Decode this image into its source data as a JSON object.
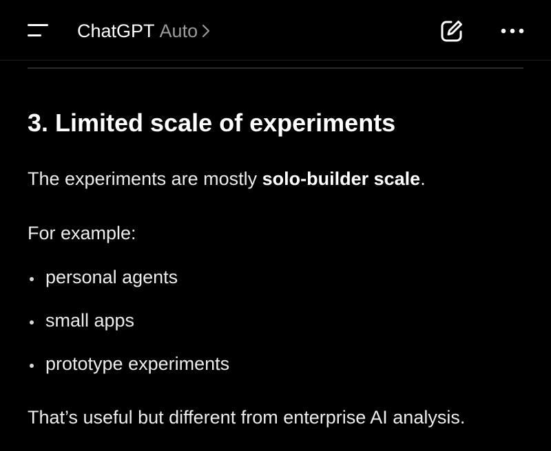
{
  "header": {
    "menu_icon": "hamburger-menu-icon",
    "title": "ChatGPT",
    "model": "Auto",
    "chevron_icon": "chevron-right-icon",
    "compose_icon": "new-chat-edit-icon",
    "more_icon": "more-horizontal-icon"
  },
  "message": {
    "heading": "3. Limited scale of experiments",
    "intro_before": "The experiments are mostly ",
    "intro_bold": "solo-builder scale",
    "intro_after": ".",
    "example_label": "For example:",
    "bullets": [
      "personal agents",
      "small apps",
      "prototype experiments"
    ],
    "closing": "That’s useful but different from enterprise AI analysis."
  },
  "colors": {
    "background": "#000000",
    "text": "#ececec",
    "muted": "#9b9b9b"
  }
}
